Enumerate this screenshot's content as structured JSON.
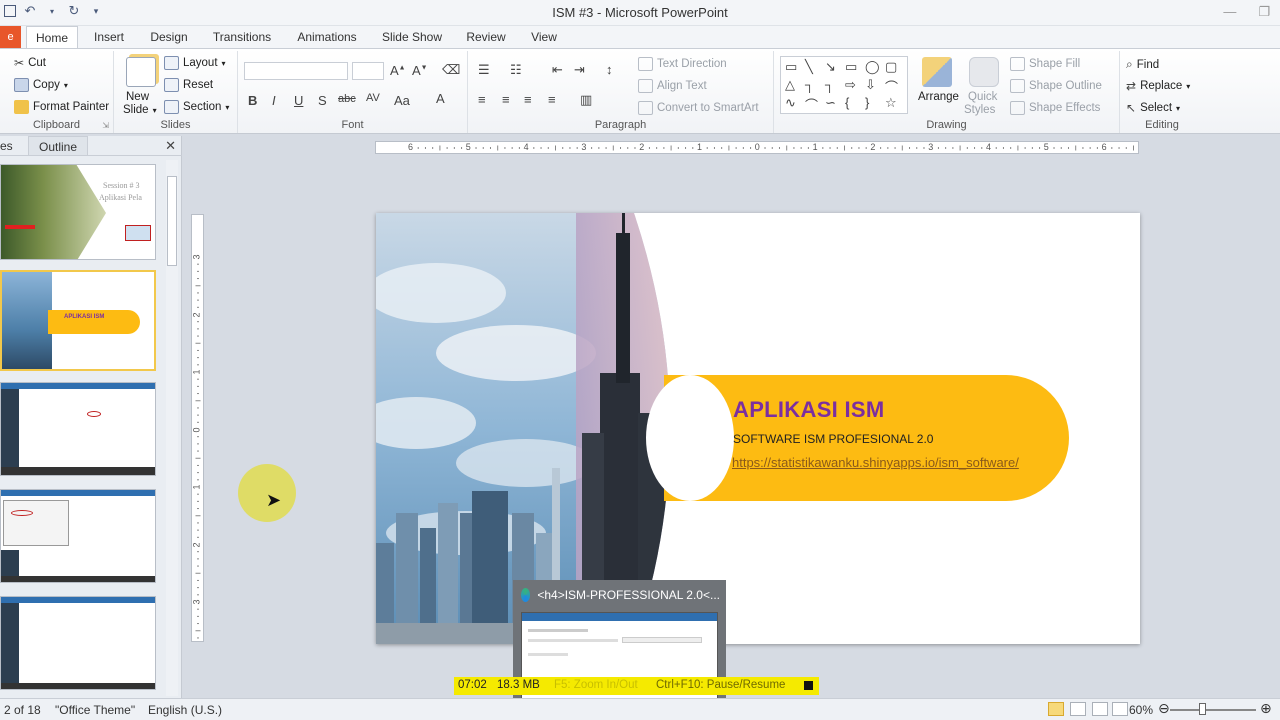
{
  "window": {
    "title": "ISM #3  -  Microsoft PowerPoint"
  },
  "ribbon": {
    "file_tab": "e",
    "tabs": [
      "Home",
      "Insert",
      "Design",
      "Transitions",
      "Animations",
      "Slide Show",
      "Review",
      "View"
    ],
    "active_tab": "Home",
    "clipboard": {
      "label": "Clipboard",
      "cut": "Cut",
      "copy": "Copy",
      "format_painter": "Format Painter"
    },
    "slides": {
      "label": "Slides",
      "new_slide": "New",
      "new_slide2": "Slide",
      "layout": "Layout",
      "reset": "Reset",
      "section": "Section"
    },
    "font": {
      "label": "Font"
    },
    "paragraph": {
      "label": "Paragraph",
      "text_direction": "Text Direction",
      "align_text": "Align Text",
      "convert_smartart": "Convert to SmartArt"
    },
    "drawing": {
      "label": "Drawing",
      "arrange": "Arrange",
      "quick_styles": "Quick",
      "quick_styles2": "Styles",
      "shape_fill": "Shape Fill",
      "shape_outline": "Shape Outline",
      "shape_effects": "Shape Effects"
    },
    "editing": {
      "label": "Editing",
      "find": "Find",
      "replace": "Replace",
      "select": "Select"
    }
  },
  "left_panel": {
    "tab_slides": "es",
    "tab_outline": "Outline",
    "thumb1_text1": "Session # 3",
    "thumb1_text2": "Aplikasi Pela",
    "thumb2_text": "APLIKASI ISM"
  },
  "ruler": {
    "h_ticks": [
      "6",
      "5",
      "4",
      "3",
      "2",
      "1",
      "0",
      "1",
      "2",
      "3",
      "4",
      "5",
      "6"
    ],
    "v_ticks": [
      "3",
      "2",
      "1",
      "0",
      "1",
      "2",
      "3"
    ]
  },
  "slide": {
    "title": "APLIKASI ISM",
    "subtitle": "SOFTWARE  ISM PROFESIONAL 2.0",
    "link": "https://statistikawanku.shinyapps.io/ism_software/"
  },
  "taskbar_preview": {
    "title": "<h4>ISM-PROFESSIONAL 2.0<..."
  },
  "recorder": {
    "time": "07:02",
    "size": "18.3 MB",
    "zoom_hint": "F5: Zoom In/Out",
    "pause_hint": "Ctrl+F10: Pause/Resume"
  },
  "status": {
    "slide_count": "2 of 18",
    "theme": "\"Office Theme\"",
    "language": "English (U.S.)",
    "zoom": "60%"
  },
  "colors": {
    "accent_yellow": "#fdbb12",
    "title_purple": "#7b2fa0",
    "file_tab": "#e8562a"
  }
}
